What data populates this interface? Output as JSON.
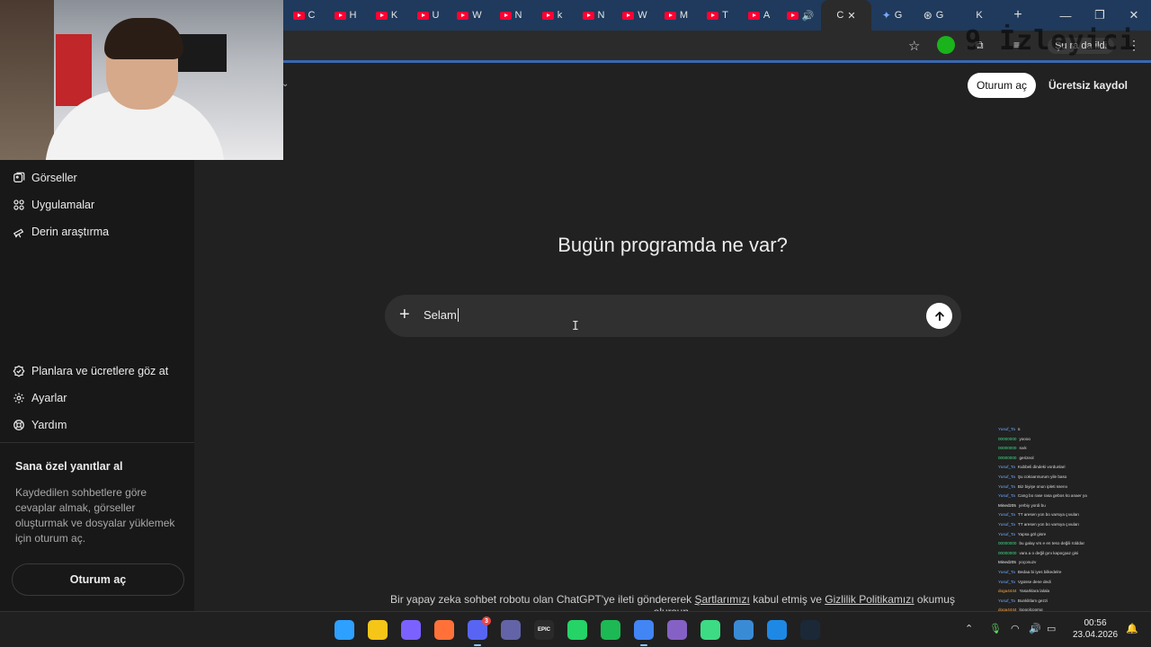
{
  "browser": {
    "tabs": [
      {
        "letter": "C",
        "icon": "youtube-icon"
      },
      {
        "letter": "H",
        "icon": "youtube-icon"
      },
      {
        "letter": "K",
        "icon": "youtube-icon"
      },
      {
        "letter": "U",
        "icon": "youtube-icon"
      },
      {
        "letter": "W",
        "icon": "youtube-icon"
      },
      {
        "letter": "N",
        "icon": "youtube-icon"
      },
      {
        "letter": "k",
        "icon": "youtube-icon"
      },
      {
        "letter": "N",
        "icon": "youtube-icon"
      },
      {
        "letter": "W",
        "icon": "youtube-icon"
      },
      {
        "letter": "M",
        "icon": "youtube-icon"
      },
      {
        "letter": "T",
        "icon": "youtube-icon"
      },
      {
        "letter": "A",
        "icon": "youtube-icon"
      },
      {
        "letter": "🔊",
        "icon": "youtube-icon"
      }
    ],
    "active_tab": {
      "letter": "C",
      "close": "✕"
    },
    "other_tabs": [
      {
        "letter": "G",
        "icon": "gemini-icon"
      },
      {
        "letter": "G",
        "icon": "chatgpt-icon"
      },
      {
        "letter": "K",
        "icon": "blank-icon"
      }
    ],
    "new_tab": "+",
    "window_controls": {
      "minimize": "—",
      "maximize": "❐",
      "close": "✕"
    },
    "profile_label": "Şu ra da ildi",
    "watermark": "9 İzleyici"
  },
  "header": {
    "login_label": "Oturum aç",
    "signup_label": "Ücretsiz kaydol"
  },
  "sidebar": {
    "items_top": [
      {
        "label": "Görseller",
        "icon": "images-icon"
      },
      {
        "label": "Uygulamalar",
        "icon": "apps-icon"
      },
      {
        "label": "Derin araştırma",
        "icon": "telescope-icon"
      }
    ],
    "items_bottom": [
      {
        "label": "Planlara ve ücretlere göz at",
        "icon": "plans-icon"
      },
      {
        "label": "Ayarlar",
        "icon": "gear-icon"
      },
      {
        "label": "Yardım",
        "icon": "help-icon"
      }
    ],
    "promo_title": "Sana özel yanıtlar al",
    "promo_text": "Kaydedilen sohbetlere göre cevaplar almak, görseller oluşturmak ve dosyalar yüklemek için oturum aç.",
    "login_label": "Oturum aç"
  },
  "main": {
    "headline": "Bugün programda ne var?",
    "composer_value": "Selam",
    "footer_prefix": "Bir yapay zeka sohbet robotu olan ChatGPT'ye ileti göndererek ",
    "footer_terms": "Şartlarımızı",
    "footer_middle": " kabul etmiş ve ",
    "footer_privacy": "Gizlilik Politikamızı",
    "footer_suffix": " okumuş olursun."
  },
  "chat_overlay": [
    {
      "user": "Yusuf_Ta",
      "text": "ü",
      "color": "#6fa8ff"
    },
    {
      "user": "00000000",
      "text": "yoooo",
      "color": "#3ddc84"
    },
    {
      "user": "00000000",
      "text": "sıvk",
      "color": "#3ddc84"
    },
    {
      "user": "00000000",
      "text": "gerizeol",
      "color": "#3ddc84"
    },
    {
      "user": "Yusuf_Ta",
      "text": "Kubbeli dindeki vordunlari",
      "color": "#6fa8ff"
    },
    {
      "user": "Yusuf_Ta",
      "text": "Şu cokoarınurum yile baso",
      "color": "#6fa8ff"
    },
    {
      "user": "Yusuf_Ta",
      "text": "Biz biyişe onun ipleti ssenıı",
      "color": "#6fa8ff"
    },
    {
      "user": "Yusuf_Ta",
      "text": "Cang bo rase rasa gebos kü anaer ya",
      "color": "#6fa8ff"
    },
    {
      "user": "Minedz05",
      "text": "yerbiy yordi bu",
      "color": "#f0f0f0"
    },
    {
      "user": "Yusuf_Ta",
      "text": "TT aresen yon bo varsıya çıvuları",
      "color": "#6fa8ff"
    },
    {
      "user": "Yusuf_Ta",
      "text": "TT aresen yon bo varsıya çıvuları",
      "color": "#6fa8ff"
    },
    {
      "user": "Yusuf_Ta",
      "text": "Yapsa göl gisre",
      "color": "#6fa8ff"
    },
    {
      "user": "00000000",
      "text": "bu galay vrs e en teso değili rülddar",
      "color": "#3ddc84"
    },
    {
      "user": "00000000",
      "text": "vara a o değil gını kapoçpaz gisi",
      "color": "#3ddc84"
    },
    {
      "user": "Minedz05",
      "text": "yoçonuzv",
      "color": "#f0f0f0"
    },
    {
      "user": "Yusuf_Ta",
      "text": "Bedaa bi iyes bilkedelre",
      "color": "#6fa8ff"
    },
    {
      "user": "Yusuf_Ta",
      "text": "Vgüsse dene dedi",
      "color": "#6fa8ff"
    },
    {
      "user": "doga4444",
      "text": "Yasarklara lalala",
      "color": "#ffa640"
    },
    {
      "user": "Yusuf_Ta",
      "text": "Bunklitlam gezzi",
      "color": "#6fa8ff"
    },
    {
      "user": "doga4444",
      "text": "loooolcoomg",
      "color": "#ffa640"
    }
  ],
  "taskbar": {
    "apps": [
      {
        "name": "windows-start",
        "label": "",
        "color": "#2ea0ff"
      },
      {
        "name": "file-explorer",
        "label": "",
        "color": "#f5c518"
      },
      {
        "name": "copilot",
        "label": "",
        "color": "#7b61ff"
      },
      {
        "name": "firefox",
        "label": "",
        "color": "#ff7139"
      },
      {
        "name": "discord",
        "label": "",
        "color": "#5865f2"
      },
      {
        "name": "teams",
        "label": "",
        "color": "#6264a7"
      },
      {
        "name": "epic-games",
        "label": "EPIC",
        "color": "#2a2a2a"
      },
      {
        "name": "whatsapp",
        "label": "",
        "color": "#25d366"
      },
      {
        "name": "spotify",
        "label": "",
        "color": "#1db954"
      },
      {
        "name": "chrome",
        "label": "",
        "color": "#4285f4"
      },
      {
        "name": "visual-studio",
        "label": "",
        "color": "#8661c5"
      },
      {
        "name": "android-studio",
        "label": "",
        "color": "#3ddc84"
      },
      {
        "name": "network-tool",
        "label": "",
        "color": "#3a8bd6"
      },
      {
        "name": "vscode",
        "label": "",
        "color": "#1e88e5"
      },
      {
        "name": "steam",
        "label": "",
        "color": "#1b2838"
      }
    ],
    "discord_badge": "3",
    "clock_time": "00:56",
    "clock_date": "23.04.2026"
  }
}
